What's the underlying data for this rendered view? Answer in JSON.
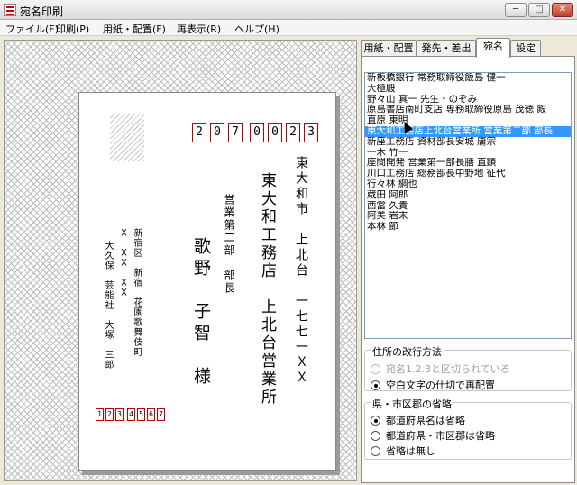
{
  "window": {
    "title": "宛名印刷",
    "minimize": "─",
    "maximize": "□",
    "close": "✕"
  },
  "menu": [
    "ファイル(F)",
    "印刷(P)",
    "用紙・配置(F)",
    "再表示(R)",
    "ヘルプ(H)"
  ],
  "postcard": {
    "zip": [
      "2",
      "0",
      "7",
      "0",
      "0",
      "2",
      "3"
    ],
    "address_line1": "東大和市　上北台　一七七一ＸＸ",
    "company": "東大和工務店　上北台営業所",
    "department": "営業第二部　部長",
    "recipient": "歌野　子智　様",
    "sender_address1": "新宿区　新宿　花園歌舞伎町",
    "sender_address2": "ＸーＸＸーＸＸ",
    "sender_name": "大久保　芸能社　大塚　三郎",
    "sender_zip": [
      "1",
      "2",
      "3",
      "4",
      "5",
      "6",
      "7"
    ]
  },
  "tabs": [
    {
      "label": "用紙・配置",
      "active": false
    },
    {
      "label": "発先・差出",
      "active": false
    },
    {
      "label": "宛名",
      "active": true
    },
    {
      "label": "設定",
      "active": false
    }
  ],
  "recipients": [
    "新板橋銀行 常務取締役飯島 健一",
    "大極殿",
    "野々山 真一 先生・のぞみ",
    "原島書店南町支店 専務取締役原島 茂徳 殿",
    "直原 東明",
    "東大和工務店上北台営業所 営業第二部 部長",
    "新座工務店 資材部長安城 庸宗",
    "一木 竹一",
    "座間開発 営業第一部長膳 直顕",
    "川口工務店 総務部長中野地 征代",
    "行々林 綱也",
    "蔵田 阿郎",
    "西當 久貴",
    "阿美 岩末",
    "本林 節"
  ],
  "selected_index": 5,
  "line_break_group": {
    "title": "住所の改行方法",
    "options": [
      {
        "label": "宛名1.2.3と区切られている",
        "checked": false,
        "enabled": false
      },
      {
        "label": "空白文字の仕切で再配置",
        "checked": true,
        "enabled": true
      }
    ]
  },
  "abbrev_group": {
    "title": "県・市区郡の省略",
    "options": [
      {
        "label": "都道府県名は省略",
        "checked": true
      },
      {
        "label": "都道府県・市区郡は省略",
        "checked": false
      },
      {
        "label": "省略は無し",
        "checked": false
      }
    ]
  }
}
